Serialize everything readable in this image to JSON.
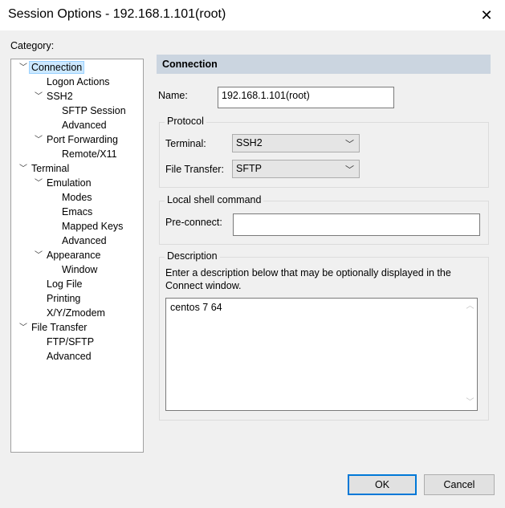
{
  "window": {
    "title": "Session Options - 192.168.1.101(root)"
  },
  "category_label": "Category:",
  "tree": {
    "connection": "Connection",
    "logon_actions": "Logon Actions",
    "ssh2": "SSH2",
    "sftp_session": "SFTP Session",
    "ssh2_advanced": "Advanced",
    "port_forwarding": "Port Forwarding",
    "remote_x11": "Remote/X11",
    "terminal": "Terminal",
    "emulation": "Emulation",
    "modes": "Modes",
    "emacs": "Emacs",
    "mapped_keys": "Mapped Keys",
    "emulation_advanced": "Advanced",
    "appearance": "Appearance",
    "window": "Window",
    "log_file": "Log File",
    "printing": "Printing",
    "xyzmodem": "X/Y/Zmodem",
    "file_transfer": "File Transfer",
    "ftp_sftp": "FTP/SFTP",
    "ft_advanced": "Advanced"
  },
  "panel": {
    "header": "Connection",
    "name_label": "Name:",
    "name_value": "192.168.1.101(root)",
    "protocol": {
      "legend": "Protocol",
      "terminal_label": "Terminal:",
      "terminal_value": "SSH2",
      "file_transfer_label": "File Transfer:",
      "file_transfer_value": "SFTP"
    },
    "local_shell": {
      "legend": "Local shell command",
      "preconnect_label": "Pre-connect:",
      "preconnect_value": ""
    },
    "description": {
      "legend": "Description",
      "hint": "Enter a description below that may be optionally displayed in the Connect window.",
      "value": "centos 7 64"
    }
  },
  "buttons": {
    "ok": "OK",
    "cancel": "Cancel"
  },
  "colors": {
    "selection": "#cce8ff",
    "header_bg": "#cbd5e0",
    "ok_border": "#0078d7"
  }
}
